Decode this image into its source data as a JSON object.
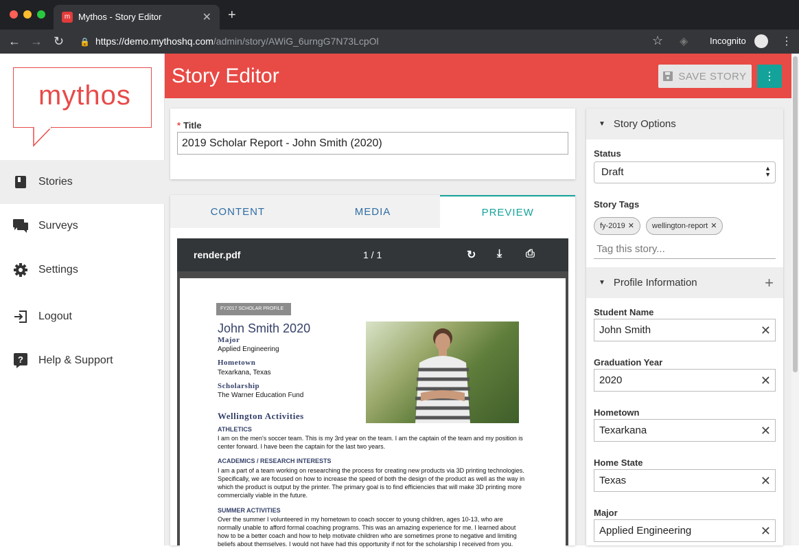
{
  "browser": {
    "tab_title": "Mythos - Story Editor",
    "tab_favicon": "m",
    "url_host": "https://demo.mythoshq.com",
    "url_path": "/admin/story/AWiG_6urngG7N73LcpOl",
    "incognito_label": "Incognito"
  },
  "logo": {
    "text": "mythos"
  },
  "nav": [
    {
      "label": "Stories",
      "icon": "book-icon"
    },
    {
      "label": "Surveys",
      "icon": "chat-icon"
    },
    {
      "label": "Settings",
      "icon": "gear-icon"
    },
    {
      "label": "Logout",
      "icon": "logout-icon"
    },
    {
      "label": "Help & Support",
      "icon": "help-icon"
    }
  ],
  "header": {
    "title": "Story Editor",
    "save_label": "SAVE STORY"
  },
  "title_field": {
    "label": "Title",
    "value": "2019 Scholar Report - John Smith (2020)"
  },
  "tabs": [
    "CONTENT",
    "MEDIA",
    "PREVIEW"
  ],
  "pdf": {
    "filename": "render.pdf",
    "page": "1 / 1",
    "badge": "FY2017 SCHOLAR PROFILE",
    "name": "John Smith 2020",
    "major_label": "Major",
    "major": "Applied Engineering",
    "hometown_label": "Hometown",
    "hometown": "Texarkana, Texas",
    "scholarship_label": "Scholarship",
    "scholarship": "The Warner Education Fund",
    "activities_title": "Wellington Activities",
    "athletics_h": "ATHLETICS",
    "athletics": "I am on the men's soccer team. This is my 3rd year on the team. I am the captain of the team and my position is center forward. I have been the captain for the last two years.",
    "academics_h": "ACADEMICS / RESEARCH INTERESTS",
    "academics": "I am a part of a team working on researching the process for creating new products via 3D printing technologies. Specifically, we are focused on how to increase the speed of both the design of the product as well as the way in which the product is output by the printer. The primary goal is to find efficiencies that will make 3D printing more commercially viable in the future.",
    "summer_h": "SUMMER ACTIVITIES",
    "summer": "Over the summer I volunteered in my hometown to coach soccer to young children, ages 10-13, who are normally unable to afford formal coaching programs. This was an amazing experience for me. I learned about how to be a better coach and how to help motivate children who are sometimes prone to negative and limiting beliefs about themselves. I would not have had this opportunity if not for the scholarship I received from you."
  },
  "options": {
    "story_options_title": "Story Options",
    "status_label": "Status",
    "status_value": "Draft",
    "tags_label": "Story Tags",
    "tags": [
      "fy-2019",
      "wellington-report"
    ],
    "tag_placeholder": "Tag this story...",
    "profile_title": "Profile Information",
    "fields": [
      {
        "label": "Student Name",
        "value": "John Smith"
      },
      {
        "label": "Graduation Year",
        "value": "2020"
      },
      {
        "label": "Hometown",
        "value": "Texarkana"
      },
      {
        "label": "Home State",
        "value": "Texas"
      },
      {
        "label": "Major",
        "value": "Applied Engineering"
      }
    ]
  },
  "colors": {
    "brand": "#e84a45",
    "accent": "#14a39a"
  }
}
